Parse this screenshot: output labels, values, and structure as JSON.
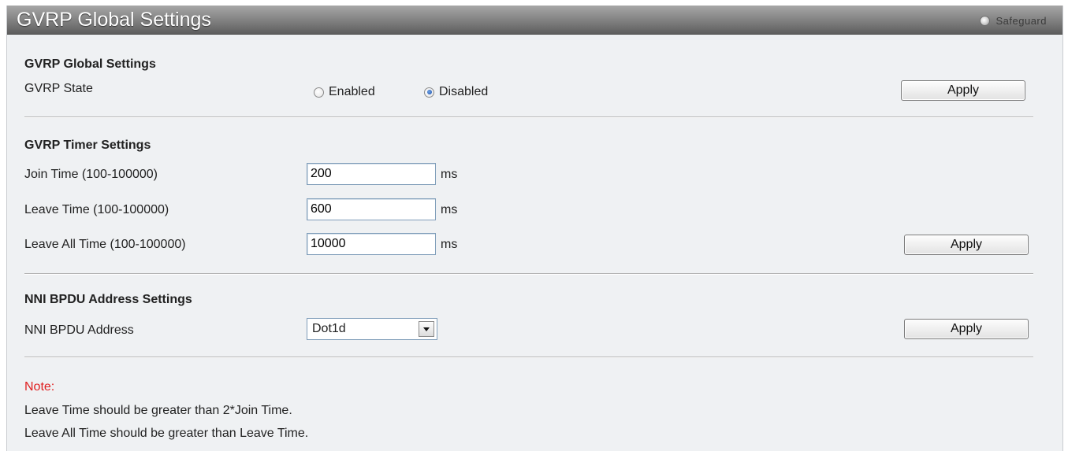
{
  "header": {
    "title": "GVRP Global Settings",
    "safeguard_label": "Safeguard"
  },
  "gvrp_global": {
    "section_title": "GVRP Global Settings",
    "state_label": "GVRP State",
    "options": [
      "Enabled",
      "Disabled"
    ],
    "selected": "Disabled",
    "apply_label": "Apply"
  },
  "gvrp_timer": {
    "section_title": "GVRP Timer Settings",
    "join_label": "Join Time (100-100000)",
    "join_value": "200",
    "leave_label": "Leave Time (100-100000)",
    "leave_value": "600",
    "leave_all_label": "Leave All Time (100-100000)",
    "leave_all_value": "10000",
    "unit": "ms",
    "apply_label": "Apply"
  },
  "nni_bpdu": {
    "section_title": "NNI BPDU Address Settings",
    "address_label": "NNI BPDU Address",
    "address_value": "Dot1d",
    "apply_label": "Apply"
  },
  "note": {
    "title": "Note:",
    "lines": [
      "Leave Time should be greater than 2*Join Time.",
      "Leave All Time should be greater than Leave Time."
    ]
  },
  "colors": {
    "note_title": "#e02020",
    "radio_checked": "#1c4fa8",
    "panel_background": "#eff1f3"
  }
}
